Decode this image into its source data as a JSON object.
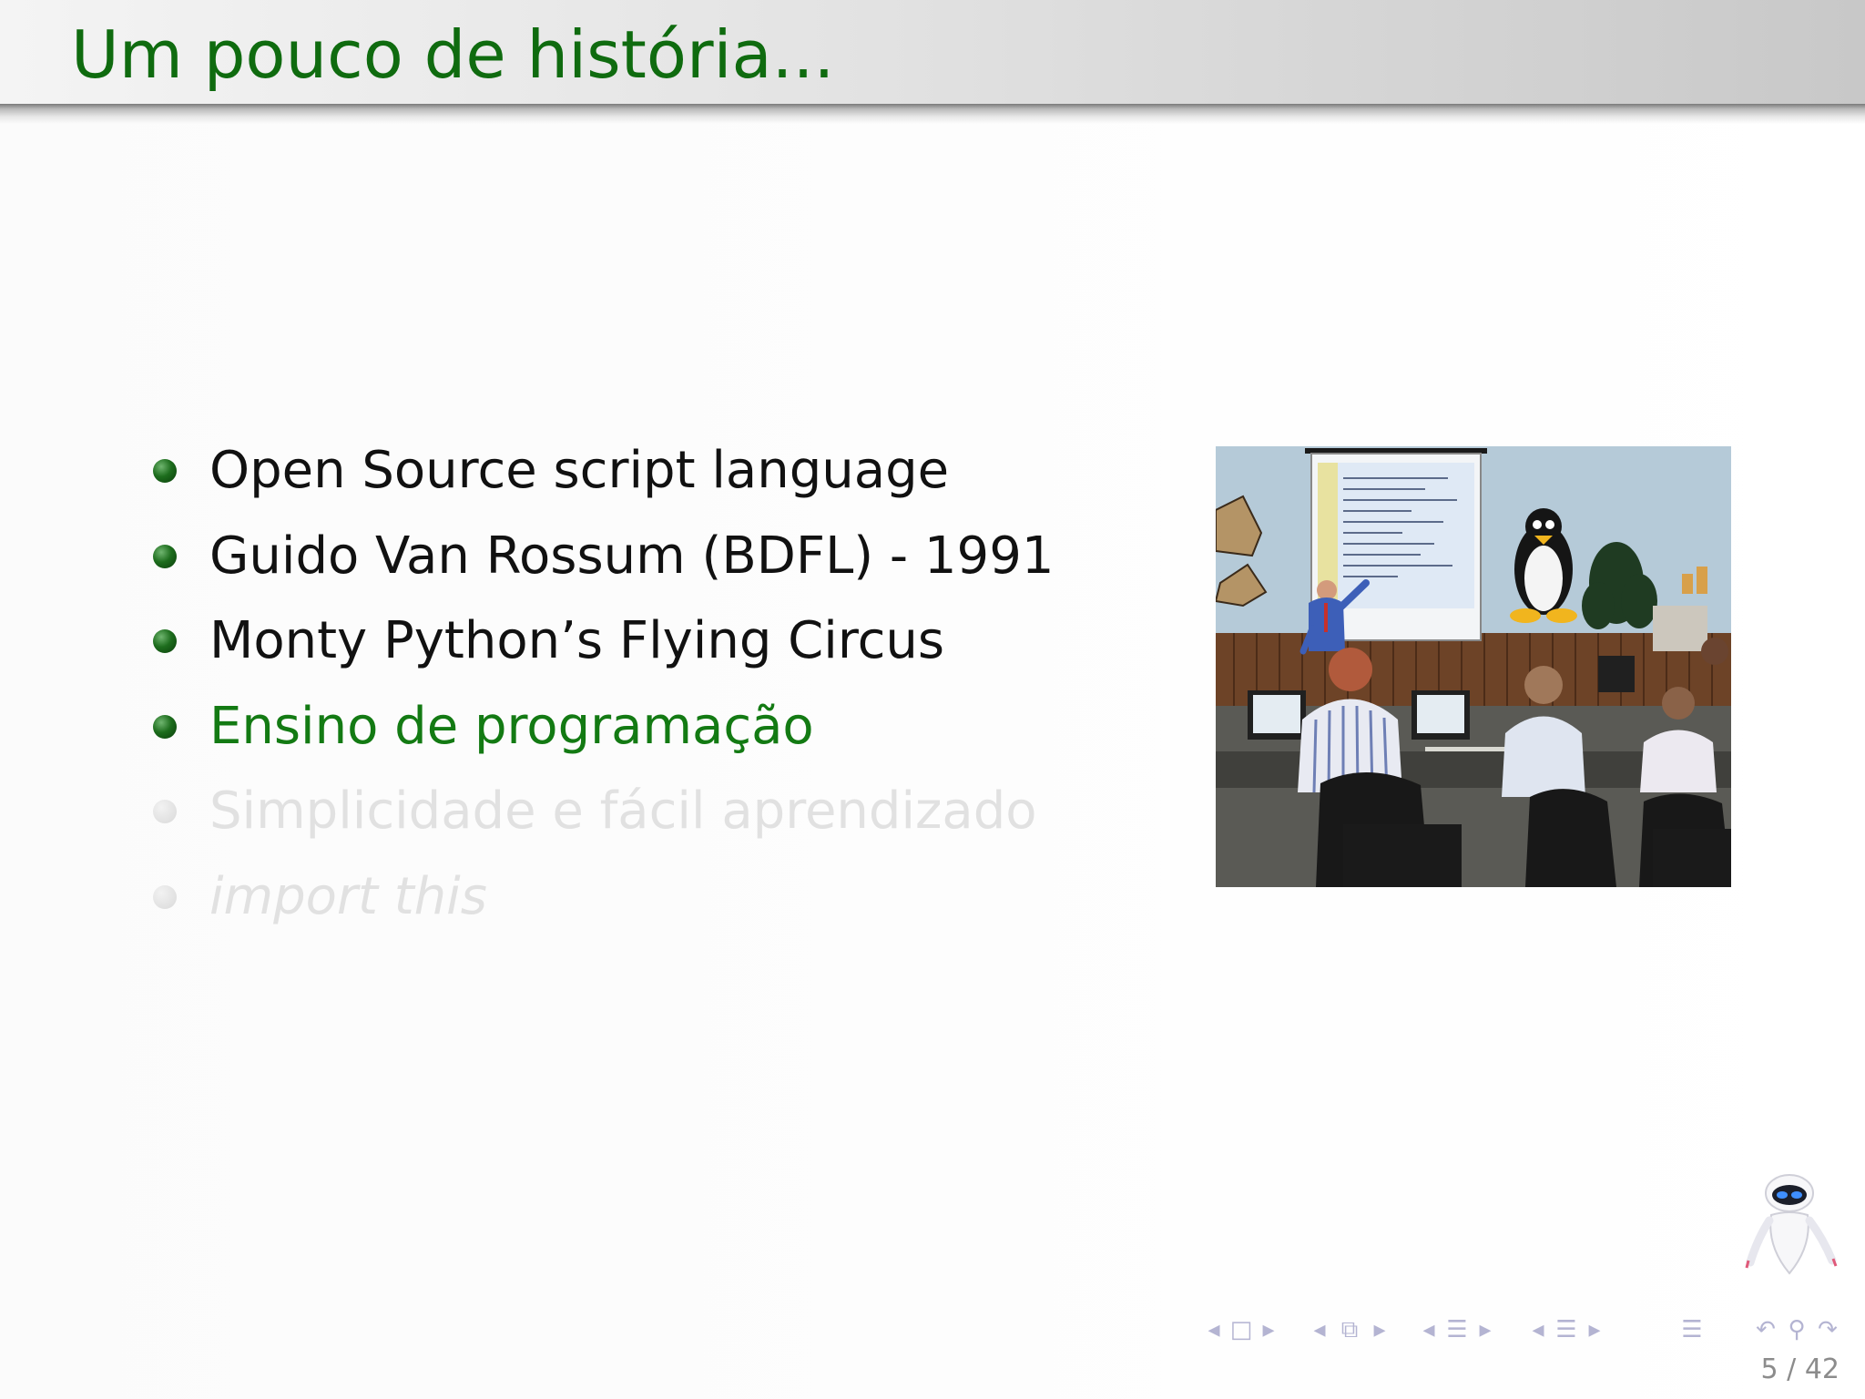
{
  "slide": {
    "title": "Um pouco de história...",
    "bullets": [
      {
        "text": "Open Source script language",
        "state": "normal",
        "style": "regular"
      },
      {
        "text": "Guido Van Rossum (BDFL) - 1991",
        "state": "normal",
        "style": "regular"
      },
      {
        "text": "Monty Python’s Flying Circus",
        "state": "normal",
        "style": "regular"
      },
      {
        "text": "Ensino de programação",
        "state": "active",
        "style": "regular"
      },
      {
        "text": "Simplicidade e fácil aprendizado",
        "state": "faded",
        "style": "regular"
      },
      {
        "text": "import this",
        "state": "faded",
        "style": "italic"
      }
    ]
  },
  "colors": {
    "title": "#0f6b0f",
    "active_bullet_text": "#137a13",
    "normal_bullet_text": "#111111",
    "faded_bullet_text": "#e1e1e1",
    "nav_icons": "#b4b4d2"
  },
  "nav": {
    "icons": [
      "nav-prev-frame-arrow-icon",
      "nav-frame-icon",
      "nav-next-frame-arrow-icon",
      "nav-prev-subsection-arrow-icon",
      "nav-subsection-icon",
      "nav-next-subsection-arrow-icon",
      "nav-prev-section-arrow-icon",
      "nav-section-icon",
      "nav-next-section-arrow-icon",
      "nav-prev-document-arrow-icon",
      "nav-document-icon",
      "nav-next-document-arrow-icon",
      "nav-toc-icon",
      "nav-back-icon",
      "nav-search-icon",
      "nav-forward-icon"
    ],
    "page_number": "5 / 42"
  },
  "images": {
    "photo": "classroom-photo",
    "mascot": "robot-mascot-icon"
  }
}
